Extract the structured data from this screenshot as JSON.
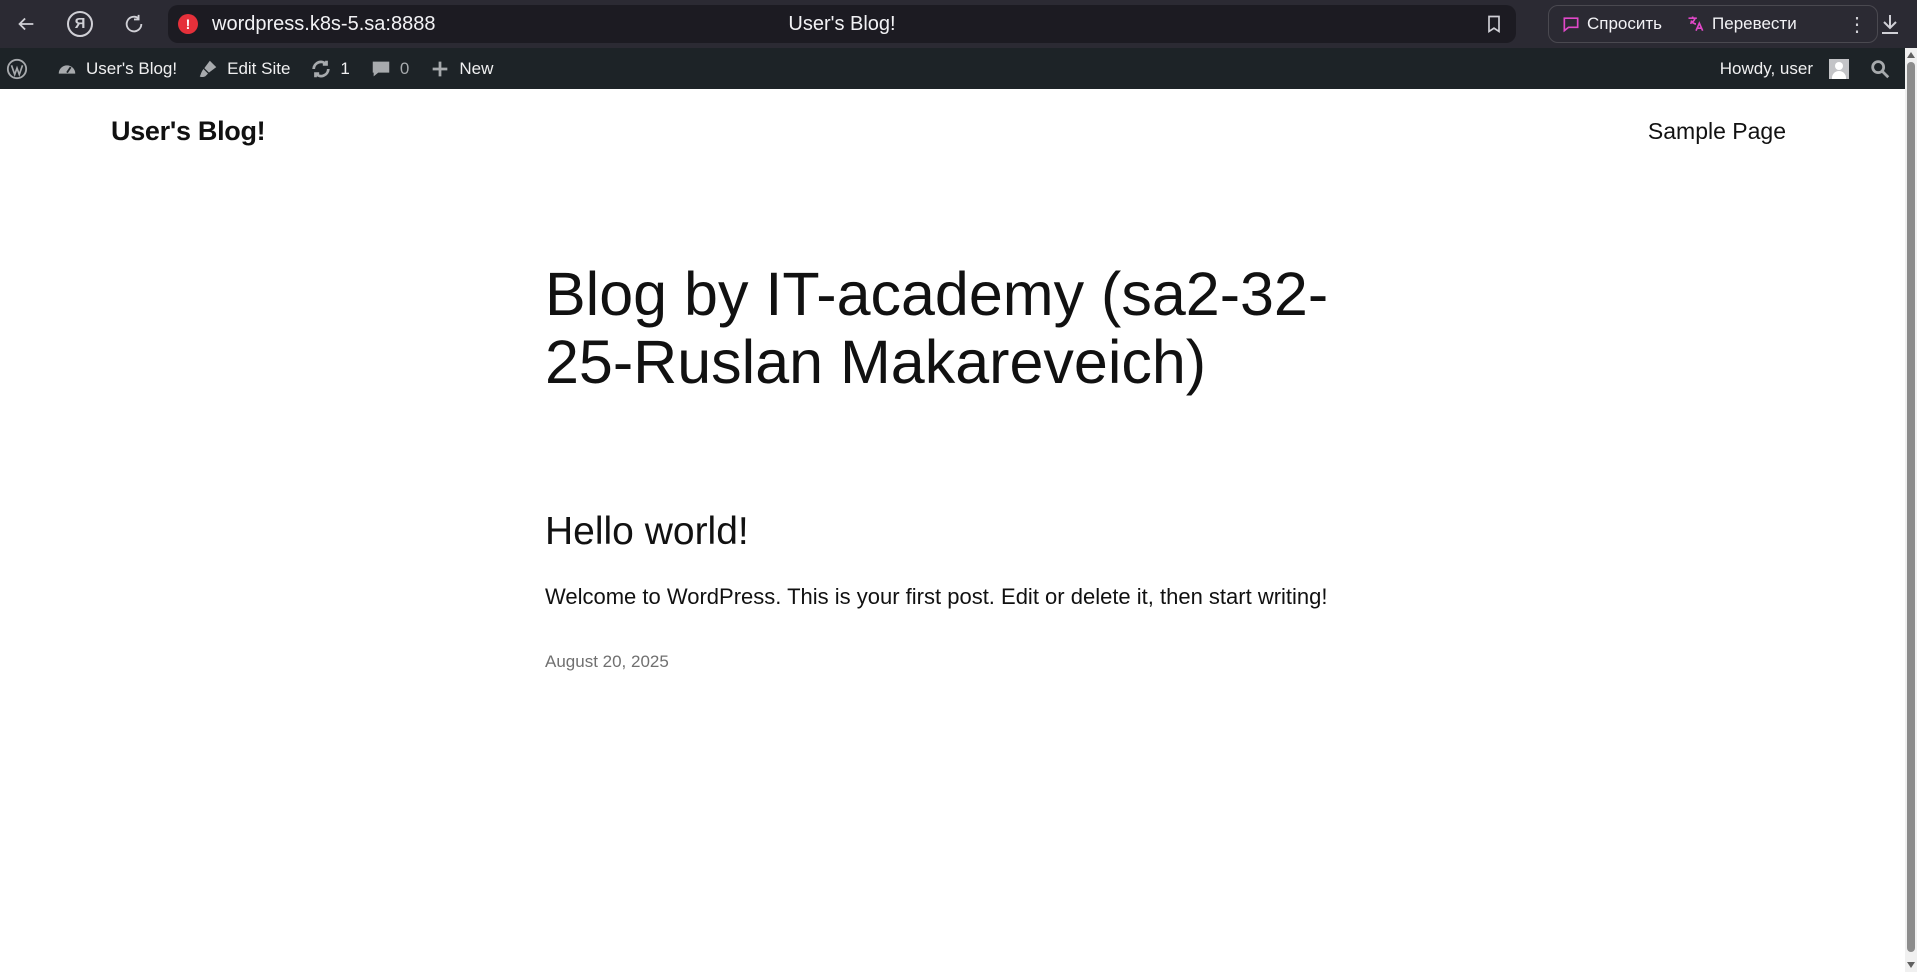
{
  "browser": {
    "url": "wordpress.k8s-5.sa:8888",
    "tab_title": "User's Blog!",
    "ask_label": "Спросить",
    "translate_label": "Перевести",
    "ya_logo": "Я"
  },
  "admin_bar": {
    "site_name": "User's Blog!",
    "edit_site": "Edit Site",
    "updates_count": "1",
    "comments_count": "0",
    "new_label": "New",
    "howdy": "Howdy, user"
  },
  "site": {
    "title": "User's Blog!",
    "nav": [
      "Sample Page"
    ]
  },
  "main": {
    "heading": "Blog by IT-academy (sa2-32-25-Ruslan Makareveich)",
    "posts": [
      {
        "title": "Hello world!",
        "excerpt": "Welcome to WordPress. This is your first post. Edit or delete it, then start writing!",
        "date": "August 20, 2025"
      }
    ]
  }
}
